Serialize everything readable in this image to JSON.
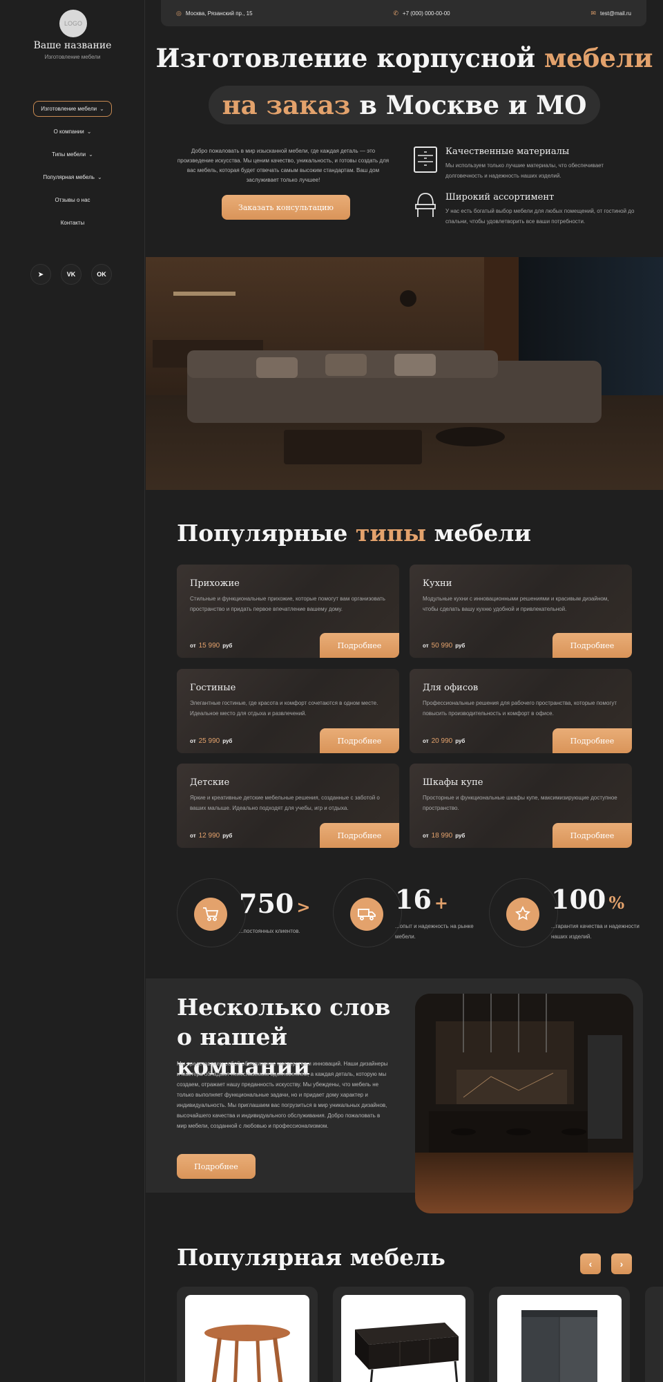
{
  "sidebar": {
    "logo_text": "LOGO",
    "brand_name": "Ваше название",
    "brand_sub": "Изготовление мебели",
    "nav": [
      {
        "label": "Изготовление мебели",
        "dropdown": true,
        "active": true
      },
      {
        "label": "О компании",
        "dropdown": true
      },
      {
        "label": "Типы мебели",
        "dropdown": true
      },
      {
        "label": "Популярная мебель",
        "dropdown": true
      },
      {
        "label": "Отзывы о нас",
        "dropdown": false
      },
      {
        "label": "Контакты",
        "dropdown": false
      }
    ],
    "socials": [
      {
        "icon": "telegram-icon",
        "glyph": "➤"
      },
      {
        "icon": "vk-icon",
        "glyph": "VK"
      },
      {
        "icon": "odnoklassniki-icon",
        "glyph": "OK"
      }
    ]
  },
  "topbar": {
    "address": "Москва, Рязанский пр., 15",
    "phone": "+7 (000) 000-00-00",
    "email": "test@mail.ru"
  },
  "hero": {
    "title_part1": "Изготовление корпусной ",
    "title_accent1": "мебели",
    "title_accent2": "на заказ",
    "title_part2": " в Москве и МО",
    "text": "Добро пожаловать в мир изысканной мебели, где каждая деталь — это произведение искусства. Мы ценим качество, уникальность, и готовы создать для вас мебель, которая будет отвечать самым высоким стандартам. Ваш дом заслуживает только лучшее!",
    "button": "Заказать консультацию",
    "features": [
      {
        "title": "Качественные материалы",
        "text": "Мы используем только лучшие материалы, что обеспечивает долговечность и надежность наших изделий.",
        "icon": "dresser-icon"
      },
      {
        "title": "Широкий ассортимент",
        "text": "У нас есть богатый выбор мебели для любых помещений, от гостиной до спальни, чтобы удовлетворить все ваши потребности.",
        "icon": "vanity-icon"
      }
    ]
  },
  "types": {
    "title_part1": "Популярные ",
    "title_accent": "типы",
    "title_part2": " мебели",
    "price_prefix": "от",
    "price_suffix": "руб",
    "button": "Подробнее",
    "cards": [
      {
        "title": "Прихожие",
        "text": "Стильные и функциональные прихожие, которые помогут вам организовать пространство и придать первое впечатление вашему дому.",
        "price": "15 990"
      },
      {
        "title": "Кухни",
        "text": "Модульные кухни с инновационными решениями и красивым дизайном, чтобы сделать вашу кухню удобной и привлекательной.",
        "price": "50 990"
      },
      {
        "title": "Гостиные",
        "text": "Элегантные гостиные, где красота и комфорт сочетаются в одном месте. Идеальное место для отдыха и развлечений.",
        "price": "25 990"
      },
      {
        "title": "Для офисов",
        "text": "Профессиональные решения для рабочего пространства, которые помогут повысить производительность и комфорт в офисе.",
        "price": "20 990"
      },
      {
        "title": "Детские",
        "text": "Яркие и креативные детские мебельные решения, созданные с заботой о ваших малыше. Идеально подходят для учебы, игр и отдыха.",
        "price": "12 990"
      },
      {
        "title": "Шкафы купе",
        "text": "Просторные и функциональные шкафы купе, максимизирующие доступное пространство.",
        "price": "18 990"
      }
    ]
  },
  "stats": [
    {
      "number": "750",
      "suffix": ">",
      "label": "...постоянных клиентов.",
      "icon": "cart-icon",
      "glyph": "🛒"
    },
    {
      "number": "16",
      "suffix": "+",
      "label": "...опыт и надежность на рынке мебели.",
      "icon": "truck-icon",
      "glyph": "⛟"
    },
    {
      "number": "100",
      "suffix": "%",
      "label": "...гарантия качества и надежности наших изделий.",
      "icon": "quality-icon",
      "glyph": "★"
    }
  ],
  "about": {
    "title": "Несколько слов о нашей компании",
    "text": "Мы представляем собой объединение мастерства и инноваций. Наши дизайнеры и мастера обладают неиссякаемым вдохновением, а каждая деталь, которую мы создаем, отражает нашу преданность искусству. Мы убеждены, что мебель не только выполняет функциональные задачи, но и придает дому характер и индивидуальность. Мы приглашаем вас погрузиться в мир уникальных дизайнов, высочайшего качества и индивидуального обслуживания. Добро пожаловать в мир мебели, созданной с любовью и профессионализмом.",
    "button": "Подробнее"
  },
  "popular": {
    "title": "Популярная мебель",
    "prev": "‹",
    "next": "›"
  }
}
